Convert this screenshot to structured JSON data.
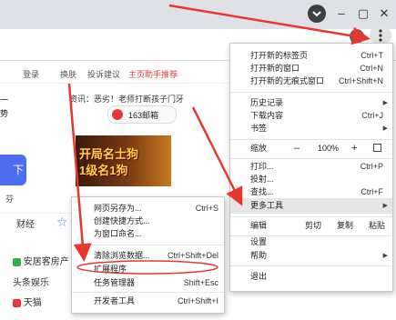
{
  "page": {
    "toplinks": [
      "登录",
      "换肤",
      "投诉建议",
      "主页助手推荐"
    ],
    "news_line": "资讯：恶劣！老师打断孩子门牙",
    "left_line1": "一",
    "left_line2": "势",
    "mail_label": "163邮箱",
    "hero_label": "下",
    "left_small": "芬",
    "nav_items": [
      "财经"
    ],
    "sites": [
      "安居客房产",
      "头条娱乐",
      "天猫"
    ],
    "banner_line1": "开局名士狗",
    "banner_line2": "1级名1狗"
  },
  "menu": {
    "items": [
      {
        "label": "打开新的标签页",
        "shortcut": "Ctrl+T"
      },
      {
        "label": "打开新的窗口",
        "shortcut": "Ctrl+N"
      },
      {
        "label": "打开新的无痕式窗口",
        "shortcut": "Ctrl+Shift+N"
      },
      {
        "label": "历史记录",
        "shortcut": ""
      },
      {
        "label": "下载内容",
        "shortcut": "Ctrl+J"
      },
      {
        "label": "书签",
        "shortcut": ""
      },
      {
        "label": "打印...",
        "shortcut": "Ctrl+P"
      },
      {
        "label": "投射...",
        "shortcut": ""
      },
      {
        "label": "查找...",
        "shortcut": "Ctrl+F"
      },
      {
        "label": "更多工具",
        "shortcut": ""
      },
      {
        "label": "设置",
        "shortcut": ""
      },
      {
        "label": "帮助",
        "shortcut": ""
      },
      {
        "label": "退出",
        "shortcut": ""
      }
    ],
    "zoom_label": "缩放",
    "zoom_minus": "–",
    "zoom_value": "100%",
    "zoom_plus": "+",
    "edit_label": "编辑",
    "cut": "剪切",
    "copy": "复制",
    "paste": "粘贴"
  },
  "submenu": {
    "items": [
      {
        "label": "网页另存为...",
        "shortcut": "Ctrl+S"
      },
      {
        "label": "创建快捷方式...",
        "shortcut": ""
      },
      {
        "label": "为窗口命名...",
        "shortcut": ""
      },
      {
        "label": "清除浏览数据...",
        "shortcut": "Ctrl+Shift+Del"
      },
      {
        "label": "扩展程序",
        "shortcut": ""
      },
      {
        "label": "任务管理器",
        "shortcut": "Shift+Esc"
      },
      {
        "label": "开发者工具",
        "shortcut": "Ctrl+Shift+I"
      }
    ]
  },
  "colors": {
    "arrow": "#e8372f",
    "highlight": "#e6e6e6",
    "hero": "#4e6ef2"
  },
  "icons": {
    "menu": "kebab-menu-icon",
    "profile": "profile-icon",
    "down": "chevron-down-icon"
  }
}
